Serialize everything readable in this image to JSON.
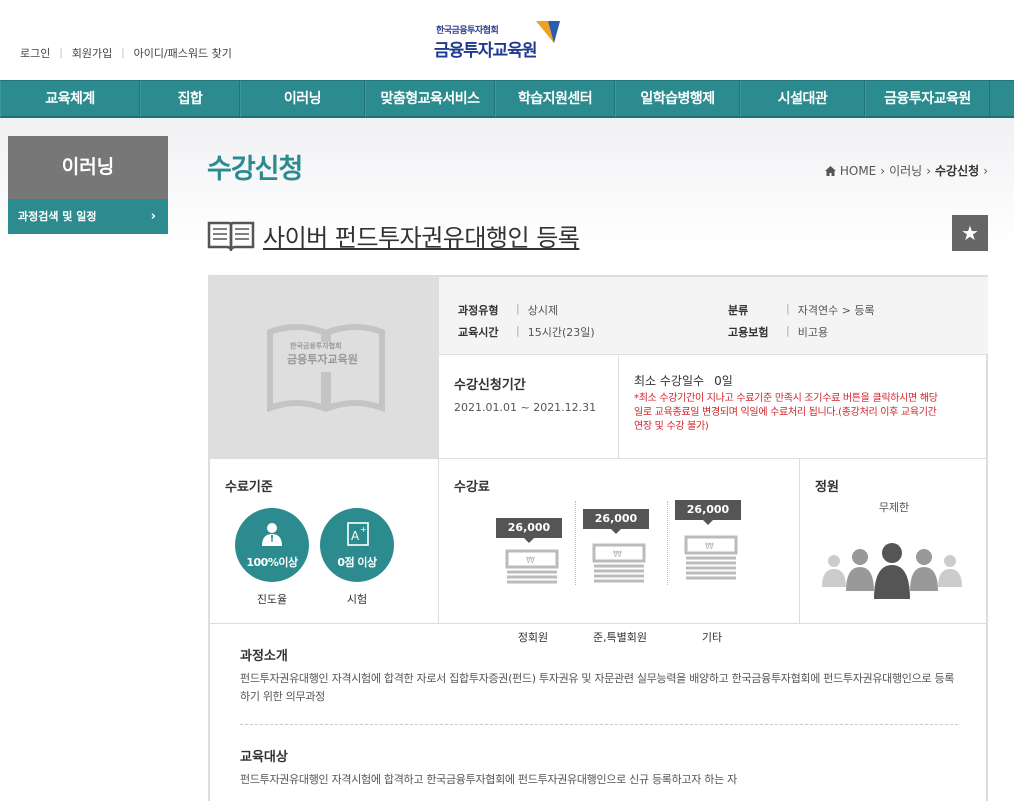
{
  "header": {
    "util_links": [
      "로그인",
      "회원가입",
      "아이디/패스워드 찾기"
    ],
    "logo_small": "한국금융투자협회",
    "logo_big": "금융투자교육원"
  },
  "nav": {
    "items": [
      "교육체계",
      "집합",
      "이러닝",
      "맞춤형교육서비스",
      "학습지원센터",
      "일학습병행제",
      "시설대관",
      "금융투자교육원"
    ]
  },
  "sidebar": {
    "title": "이러닝",
    "item": "과정검색 및 일정"
  },
  "page": {
    "title": "수강신청",
    "breadcrumb": [
      "HOME",
      "이러닝",
      "수강신청"
    ]
  },
  "course": {
    "title": "사이버 펀드투자권유대행인 등록",
    "thumb_logo": "금융투자교육원",
    "thumb_logo_small": "한국금융투자협회",
    "meta": {
      "type_label": "과정유형",
      "type_value": "상시제",
      "category_label": "분류",
      "category_value": "자격연수 > 등록",
      "hours_label": "교육시간",
      "hours_value": "15시간(23일)",
      "insurance_label": "고용보험",
      "insurance_value": "비고용"
    },
    "period_label": "수강신청기간",
    "period_value": "2021.01.01 ~ 2021.12.31",
    "min_days_label": "최소 수강일수",
    "min_days_value": "0일",
    "min_days_note": "*최소 수강기간이 지나고 수료기준 만족시 조기수료 버튼을 클릭하시면 해당일로 교육종료일 변경되며 익일에 수료처리 됩니다.(종강처리 이후 교육기간 연장 및 수강 불가)",
    "criteria_label": "수료기준",
    "criteria": [
      {
        "value": "100%이상",
        "label": "진도율"
      },
      {
        "value": "0점 이상",
        "label": "시험"
      }
    ],
    "fee_label": "수강료",
    "fees": [
      {
        "price": "26,000",
        "label": "정회원"
      },
      {
        "price": "26,000",
        "label": "준,특별회원"
      },
      {
        "price": "26,000",
        "label": "기타"
      }
    ],
    "capacity_label": "정원",
    "capacity_value": "무제한",
    "intro_label": "과정소개",
    "intro_text": "펀드투자권유대행인 자격시험에 합격한 자로서 집합투자증권(펀드) 투자권유 및 자문관련 실무능력을 배양하고 한국금융투자협회에 펀드투자권유대행인으로 등록하기 위한 의무과정",
    "target_label": "교육대상",
    "target_text": "펀드투자권유대행인 자격시험에 합격하고 한국금융투자협회에 펀드투자권유대행인으로 신규 등록하고자 하는 자"
  },
  "colors": {
    "teal": "#2b8b8e",
    "gray": "#777777",
    "red_note": "#d2232a"
  }
}
